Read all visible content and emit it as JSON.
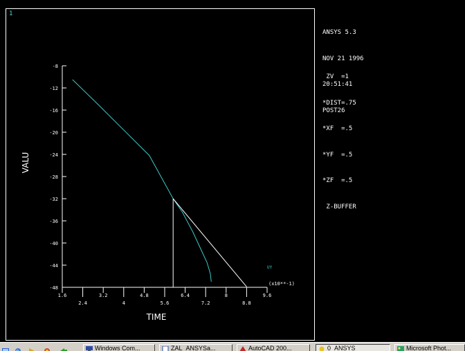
{
  "window_number": "1",
  "info_header": [
    "ANSYS 5.3",
    "NOV 21 1996",
    "20:51:41",
    "POST26"
  ],
  "info_view": [
    " ZV  =1",
    "*DIST=.75",
    "*XF  =.5",
    "*YF  =.5",
    "*ZF  =.5",
    " Z-BUFFER"
  ],
  "chart_data": {
    "type": "line",
    "xlabel": "TIME",
    "ylabel": "VALU",
    "x_multiplier_label": "(x10**-1)",
    "xlim": [
      1.6,
      9.6
    ],
    "ylim": [
      -48,
      -8
    ],
    "x_ticks_top_row": [
      "1.6",
      "3.2",
      "4.8",
      "6.4",
      "8",
      "9.6"
    ],
    "x_ticks_bottom_row": [
      "2.4",
      "4",
      "5.6",
      "7.2",
      "8.8"
    ],
    "x_tick_values_top_row": [
      1.6,
      3.2,
      4.8,
      6.4,
      8,
      9.6
    ],
    "x_tick_values_bottom_row": [
      2.4,
      4,
      5.6,
      7.2,
      8.8
    ],
    "y_ticks": [
      "-8",
      "-12",
      "-16",
      "-20",
      "-24",
      "-28",
      "-32",
      "-36",
      "-40",
      "-44",
      "-48"
    ],
    "y_tick_values": [
      -8,
      -12,
      -16,
      -20,
      -24,
      -28,
      -32,
      -36,
      -40,
      -44,
      -48
    ],
    "series": [
      {
        "name": "UY",
        "color": "#3fc8c8",
        "x": [
          2.0,
          3.0,
          4.0,
          5.0,
          5.93,
          6.3,
          6.7,
          7.0,
          7.25,
          7.38,
          7.42
        ],
        "y": [
          -10.5,
          -15.0,
          -19.6,
          -24.2,
          -32.0,
          -34.5,
          -38.0,
          -41.0,
          -43.5,
          -45.5,
          -47.0
        ]
      },
      {
        "name": "",
        "color": "#ffffff",
        "x": [
          5.93,
          8.8
        ],
        "y": [
          -32.0,
          -47.9
        ]
      },
      {
        "name": "",
        "color": "#ffffff",
        "x": [
          5.93,
          5.93
        ],
        "y": [
          -32.0,
          -48
        ]
      }
    ],
    "legend": "bottom-right"
  },
  "taskbar": {
    "items": [
      {
        "label": "Windows Com...",
        "icon": "computer-icon",
        "active": false
      },
      {
        "label": "ZAL_ANSYSa...",
        "icon": "document-icon",
        "active": false
      },
      {
        "label": "AutoCAD 200...",
        "icon": "autocad-icon",
        "active": false
      },
      {
        "label": "0_ANSYS",
        "icon": "ansys-icon",
        "active": true
      },
      {
        "label": "Microsoft Phot...",
        "icon": "photo-icon",
        "active": false
      }
    ]
  }
}
